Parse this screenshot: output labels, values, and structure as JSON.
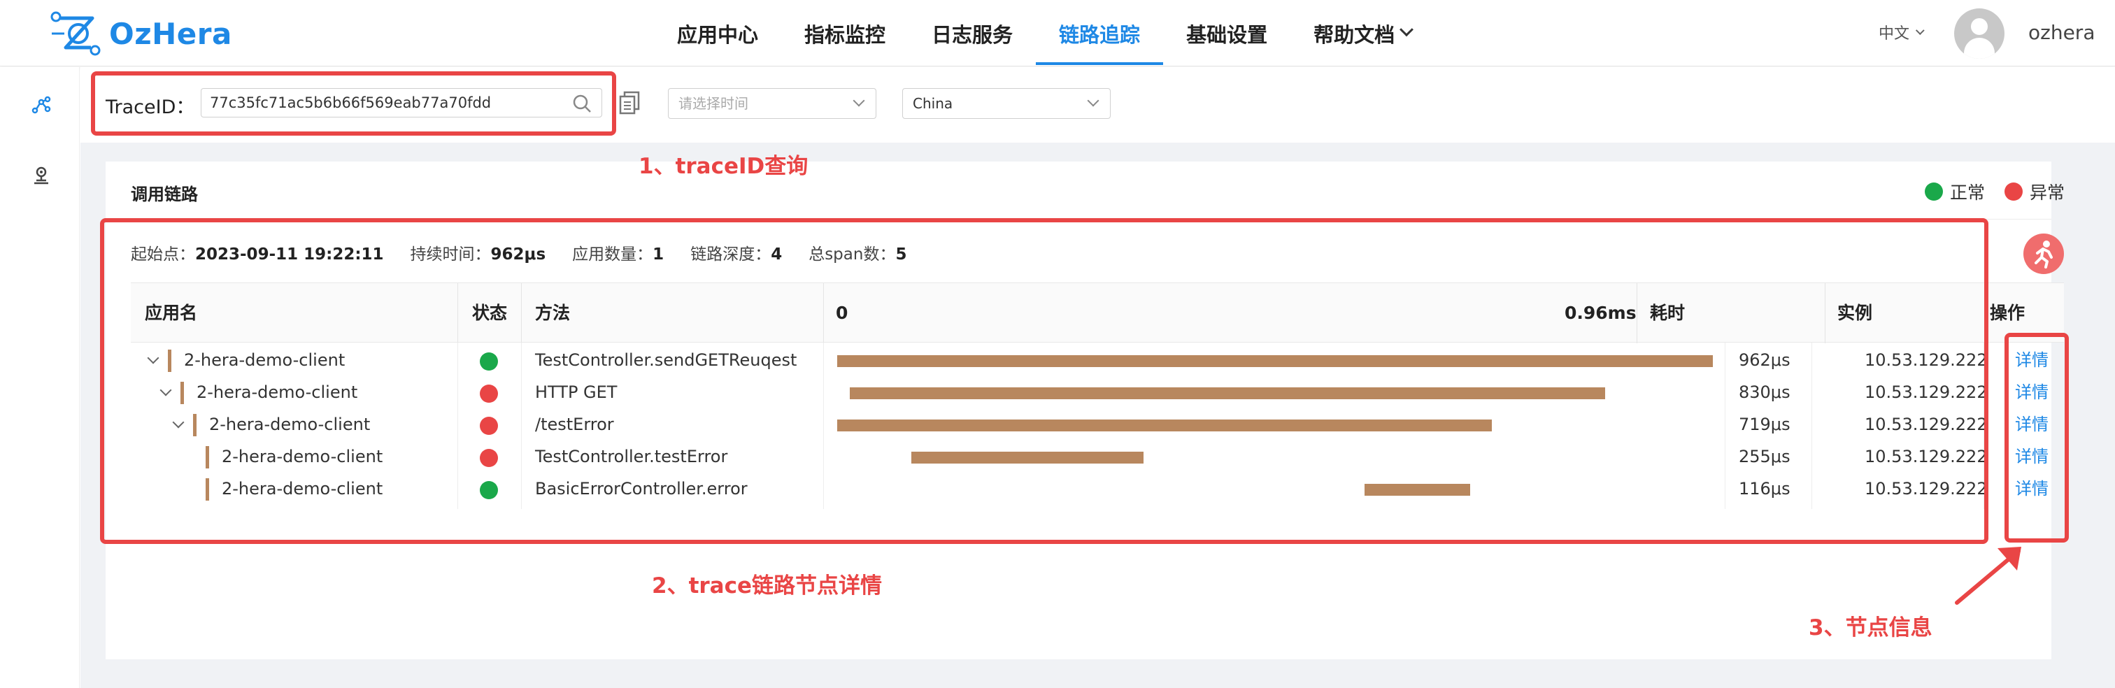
{
  "app": {
    "name": "OzHera"
  },
  "nav": {
    "items": [
      {
        "label": "应用中心"
      },
      {
        "label": "指标监控"
      },
      {
        "label": "日志服务"
      },
      {
        "label": "链路追踪",
        "active": true
      },
      {
        "label": "基础设置"
      },
      {
        "label": "帮助文档",
        "dropdown": true
      }
    ],
    "language": "中文",
    "username": "ozhera"
  },
  "search": {
    "trace_label": "TraceID：",
    "trace_value": "77c35fc71ac5b6b66f569eab77a70fdd",
    "time_placeholder": "请选择时间",
    "region_value": "China"
  },
  "panel": {
    "title": "调用链路",
    "legend": [
      {
        "label": "正常",
        "color": "#1aa84a"
      },
      {
        "label": "异常",
        "color": "#e94545"
      }
    ]
  },
  "summary": {
    "start_label": "起始点：",
    "start_value": "2023-09-11 19:22:11",
    "duration_label": "持续时间：",
    "duration_value": "962μs",
    "app_count_label": "应用数量：",
    "app_count_value": "1",
    "depth_label": "链路深度：",
    "depth_value": "4",
    "span_label": "总span数：",
    "span_value": "5"
  },
  "table": {
    "headers": {
      "app": "应用名",
      "status": "状态",
      "method": "方法",
      "timeline_start": "0",
      "timeline_end": "0.96ms",
      "duration": "耗时",
      "instance": "实例",
      "action": "操作"
    },
    "rows": [
      {
        "app": "2-hera-demo-client",
        "level": 0,
        "expandable": true,
        "status": "normal",
        "method": "TestController.sendGETReuqest",
        "duration": "962μs",
        "instance": "10.53.129.222",
        "action": "详情",
        "bar_start": 0.0,
        "bar_fraction": 1.0
      },
      {
        "app": "2-hera-demo-client",
        "level": 1,
        "expandable": true,
        "status": "error",
        "method": "HTTP GET",
        "duration": "830μs",
        "instance": "10.53.129.222",
        "action": "详情",
        "bar_start": 0.014,
        "bar_fraction": 0.863
      },
      {
        "app": "2-hera-demo-client",
        "level": 2,
        "expandable": true,
        "status": "error",
        "method": "/testError",
        "duration": "719μs",
        "instance": "10.53.129.222",
        "action": "详情",
        "bar_start": 0.0,
        "bar_fraction": 0.748
      },
      {
        "app": "2-hera-demo-client",
        "level": 3,
        "expandable": false,
        "status": "error",
        "method": "TestController.testError",
        "duration": "255μs",
        "instance": "10.53.129.222",
        "action": "详情",
        "bar_start": 0.085,
        "bar_fraction": 0.265
      },
      {
        "app": "2-hera-demo-client",
        "level": 3,
        "expandable": false,
        "status": "normal",
        "method": "BasicErrorController.error",
        "duration": "116μs",
        "instance": "10.53.129.222",
        "action": "详情",
        "bar_start": 0.602,
        "bar_fraction": 0.121
      }
    ]
  },
  "annotations": {
    "a1": "1、traceID查询",
    "a2": "2、trace链路节点详情",
    "a3": "3、节点信息"
  },
  "colors": {
    "accent": "#1e88e5",
    "normal": "#1aa84a",
    "error": "#e94545",
    "bar": "#b8875e",
    "annotation": "#e94545"
  }
}
